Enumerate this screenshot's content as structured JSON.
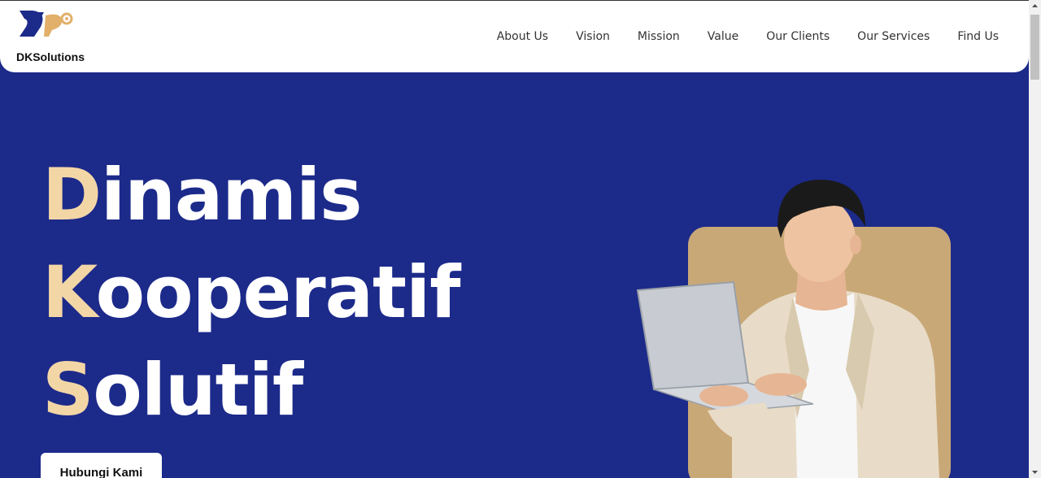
{
  "header": {
    "brand": "DKSolutions",
    "nav": [
      "About Us",
      "Vision",
      "Mission",
      "Value",
      "Our Clients",
      "Our Services",
      "Find Us"
    ]
  },
  "hero": {
    "lines": [
      {
        "cap": "D",
        "rest": "inamis"
      },
      {
        "cap": "K",
        "rest": "ooperatif"
      },
      {
        "cap": "S",
        "rest": "olutif"
      }
    ],
    "cta": "Hubungi Kami"
  },
  "colors": {
    "hero_bg": "#1c2a8a",
    "accent_letters": "#f3d6a6",
    "photo_bg": "#c9a878",
    "header_bg": "#ffffff"
  },
  "icons": [
    "dk-logo-icon",
    "scroll-up-arrow-icon",
    "scroll-down-arrow-icon"
  ]
}
